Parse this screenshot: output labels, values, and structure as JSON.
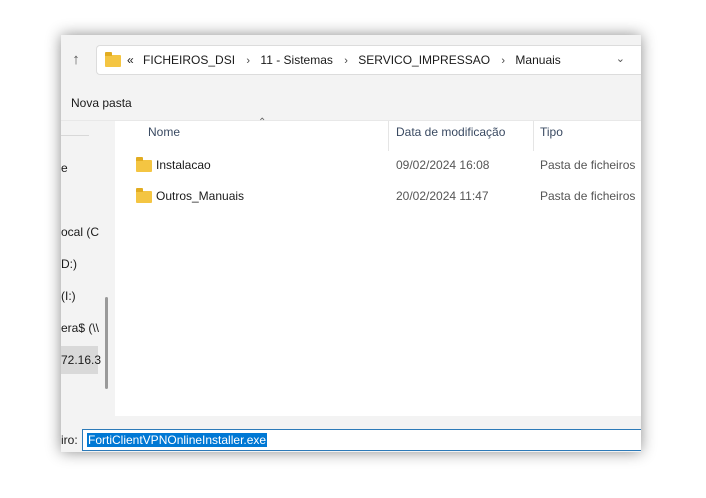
{
  "address": {
    "back_icon": "arrow-up-icon",
    "prefix": "«",
    "crumbs": [
      "FICHEIROS_DSI",
      "11 - Sistemas",
      "SERVICO_IMPRESSAO",
      "Manuais"
    ],
    "separator": "›",
    "dropdown_icon": "chevron-down-icon"
  },
  "commandbar": {
    "new_folder": "Nova pasta"
  },
  "nav": {
    "items": [
      "e",
      "ocal (C",
      "D:)",
      "(I:)",
      "era$ (\\\\",
      "72.16.3"
    ]
  },
  "columns": {
    "name": "Nome",
    "date": "Data de modificação",
    "type": "Tipo",
    "sort_icon": "sort-up-icon"
  },
  "files": [
    {
      "name": "Instalacao",
      "date": "09/02/2024 16:08",
      "type": "Pasta de ficheiros"
    },
    {
      "name": "Outros_Manuais",
      "date": "20/02/2024 11:47",
      "type": "Pasta de ficheiros"
    }
  ],
  "footer": {
    "label": "iro:",
    "filename": "FortiClientVPNOnlineInstaller.exe"
  },
  "colors": {
    "folder": "#f4c542",
    "selection": "#0078d4"
  }
}
